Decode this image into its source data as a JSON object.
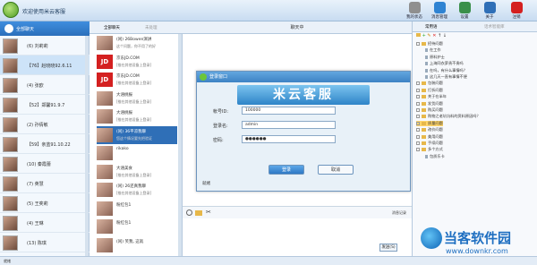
{
  "app": {
    "title": "欢迎使用米云客服"
  },
  "toolbar": [
    {
      "label": "我的状态",
      "color": "#8f8f8f"
    },
    {
      "label": "消息管理",
      "color": "#2f83d2"
    },
    {
      "label": "设置",
      "color": "#3a8f4a"
    },
    {
      "label": "关于",
      "color": "#2f6fb7"
    },
    {
      "label": "注销",
      "color": "#d42020"
    }
  ],
  "left": {
    "selected": "全部聊天",
    "contacts": [
      "(6) 刘莉莉",
      "【76】赵晓晓92.6.11",
      "(4) 张欧",
      "【52】郑馨91.9.7",
      "(2) 孙倩敏",
      "【59】亲蓝91.10.22",
      "(10) 秦霞蕾",
      "(7) 英慧",
      "(5) 王奕莉",
      "(4) 王琳",
      "(13) 陈琪"
    ]
  },
  "mid": {
    "tabs": [
      "全部聊天",
      "未处理"
    ],
    "rows": [
      {
        "l1": "(闲) 26Bowen演讲",
        "l2": "这个问题，你不用了的好"
      },
      {
        "l1": "京东JD.COM",
        "l2": "[推在其他设备上登录]"
      },
      {
        "l1": "京东JD.COM",
        "l2": "[推在其他设备上登录]"
      },
      {
        "l1": "大涵桃报",
        "l2": "[推在其他设备上登录]"
      },
      {
        "l1": "大涵桃报",
        "l2": "[推在其他设备上登录]"
      },
      {
        "l1": "(闲) 36平凉我聊",
        "l2": "您这个情况要先把验证"
      },
      {
        "l1": "rikako",
        "l2": ""
      },
      {
        "l1": "大涵美食",
        "l2": "[推在其他设备上登录]"
      },
      {
        "l1": "(闲) 26还真我聊",
        "l2": "[推在其他设备上登录]"
      },
      {
        "l1": "粉红包1",
        "l2": ""
      },
      {
        "l1": "粉红包1",
        "l2": ""
      },
      {
        "l1": "(闲) 笑我, 这就",
        "l2": ""
      }
    ]
  },
  "chat": {
    "header": "聊天中",
    "records": "消息记录",
    "send": "发送(S)"
  },
  "dialog": {
    "title": "登录窗口",
    "banner": "米云客服",
    "account_label": "帐号ID:",
    "account_value": "100000",
    "user_label": "登录名:",
    "user_value": "admin",
    "pwd_label": "密码:",
    "pwd_value": "●●●●●●",
    "login": "登录",
    "cancel": "取消",
    "status": "就绪"
  },
  "right": {
    "tabs": [
      "常用语",
      "话术智能库"
    ],
    "tree": [
      {
        "t": "招待问题",
        "lvl": 0,
        "kind": "fd"
      },
      {
        "t": "在工作",
        "lvl": 1,
        "kind": "lf"
      },
      {
        "t": "原料护士",
        "lvl": 1,
        "kind": "lf"
      },
      {
        "t": "上海同衣萝贵不贵吗",
        "lvl": 1,
        "kind": "lf"
      },
      {
        "t": "在吗，有什么事情吗？",
        "lvl": 1,
        "kind": "lf"
      },
      {
        "t": "这几天一直有事情不便",
        "lvl": 1,
        "kind": "lf"
      },
      {
        "t": "包装问题",
        "lvl": 0,
        "kind": "fd"
      },
      {
        "t": "打折问题",
        "lvl": 0,
        "kind": "fd"
      },
      {
        "t": "关于在半年",
        "lvl": 0,
        "kind": "fd"
      },
      {
        "t": "发货问题",
        "lvl": 0,
        "kind": "fd"
      },
      {
        "t": "购买问题",
        "lvl": 0,
        "kind": "fd"
      },
      {
        "t": "购物之老坑坑料的资料原因吗？",
        "lvl": 0,
        "kind": "fd"
      },
      {
        "t": "质量问题",
        "lvl": 0,
        "kind": "fd",
        "sel": true
      },
      {
        "t": "改价问题",
        "lvl": 0,
        "kind": "fd"
      },
      {
        "t": "美用问题",
        "lvl": 0,
        "kind": "fd"
      },
      {
        "t": "手续问题",
        "lvl": 0,
        "kind": "fd"
      },
      {
        "t": "多个方式",
        "lvl": 0,
        "kind": "fd"
      },
      {
        "t": "包质乐卡",
        "lvl": 1,
        "kind": "lf"
      }
    ]
  },
  "statusbar": {
    "text": "就绪"
  },
  "watermark": {
    "title": "当客软件园",
    "url": "www.downkr.com"
  }
}
